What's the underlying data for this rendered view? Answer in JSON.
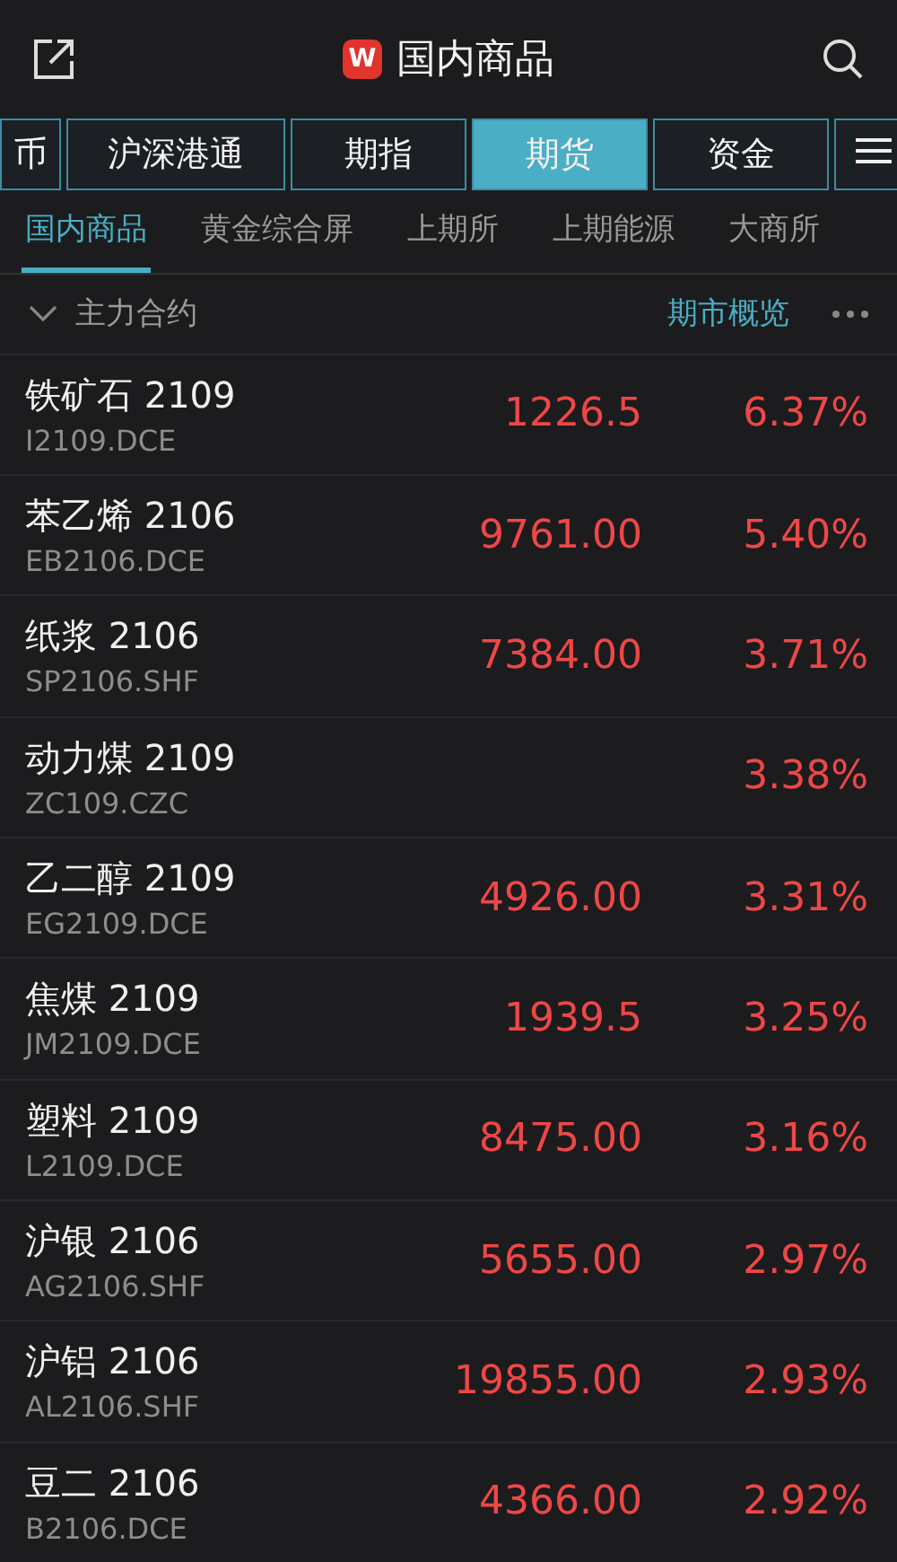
{
  "header": {
    "title": "国内商品",
    "logo": "W"
  },
  "tabs": [
    {
      "label": "币",
      "selected": false
    },
    {
      "label": "沪深港通",
      "selected": false
    },
    {
      "label": "期指",
      "selected": false
    },
    {
      "label": "期货",
      "selected": true
    },
    {
      "label": "资金",
      "selected": false
    }
  ],
  "subtabs": [
    {
      "label": "国内商品",
      "selected": true
    },
    {
      "label": "黄金综合屏",
      "selected": false
    },
    {
      "label": "上期所",
      "selected": false
    },
    {
      "label": "上期能源",
      "selected": false
    },
    {
      "label": "大商所",
      "selected": false
    }
  ],
  "section": {
    "title": "主力合约",
    "expanded": true,
    "link": "期市概览"
  },
  "rows": [
    {
      "name": "铁矿石 2109",
      "code": "I2109.DCE",
      "price": "1226.5",
      "change": "6.37%"
    },
    {
      "name": "苯乙烯 2106",
      "code": "EB2106.DCE",
      "price": "9761.00",
      "change": "5.40%"
    },
    {
      "name": "纸浆 2106",
      "code": "SP2106.SHF",
      "price": "7384.00",
      "change": "3.71%"
    },
    {
      "name": "动力煤 2109",
      "code": "ZC109.CZC",
      "change": "3.38%"
    },
    {
      "name": "乙二醇 2109",
      "code": "EG2109.DCE",
      "price": "4926.00",
      "change": "3.31%"
    },
    {
      "name": "焦煤 2109",
      "code": "JM2109.DCE",
      "price": "1939.5",
      "change": "3.25%"
    },
    {
      "name": "塑料 2109",
      "code": "L2109.DCE",
      "price": "8475.00",
      "change": "3.16%"
    },
    {
      "name": "沪银 2106",
      "code": "AG2106.SHF",
      "price": "5655.00",
      "change": "2.97%"
    },
    {
      "name": "沪铝 2106",
      "code": "AL2106.SHF",
      "price": "19855.00",
      "change": "2.93%"
    },
    {
      "name": "豆二 2106",
      "code": "B2106.DCE",
      "price": "4366.00",
      "change": "2.92%"
    }
  ]
}
